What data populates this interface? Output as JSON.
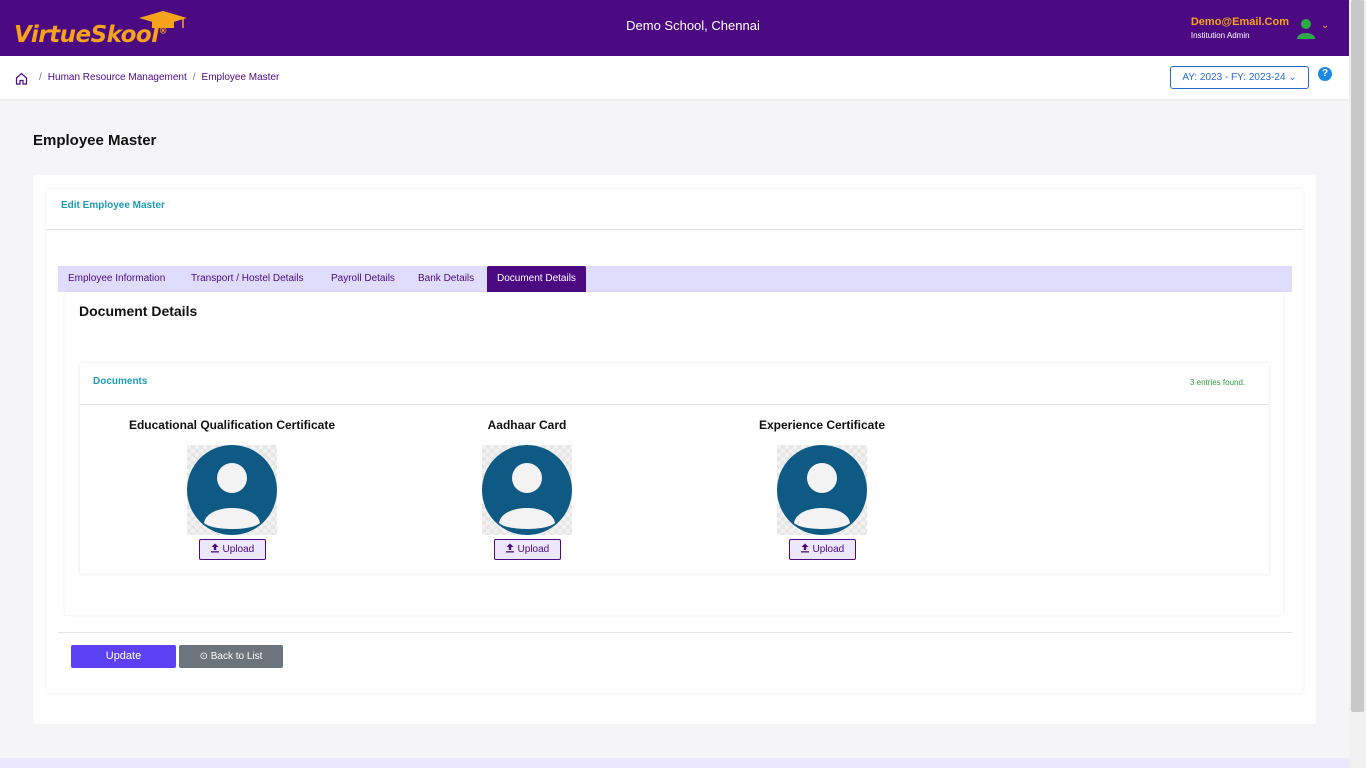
{
  "header": {
    "logo_virtue": "Virtue",
    "logo_skool": "Skool",
    "logo_reg": "®",
    "school_name": "Demo School, Chennai",
    "user_email": "Demo@Email.Com",
    "user_role": "Institution Admin"
  },
  "breadcrumb": {
    "items": [
      "Human Resource Management",
      "Employee Master"
    ],
    "separator": "/",
    "ay_fy": "AY: 2023 - FY: 2023-24 ⌄",
    "help": "?"
  },
  "page": {
    "title": "Employee Master",
    "edit_title": "Edit Employee Master"
  },
  "tabs": [
    {
      "label": "Employee Information",
      "active": false
    },
    {
      "label": "Transport / Hostel Details",
      "active": false
    },
    {
      "label": "Payroll Details",
      "active": false
    },
    {
      "label": "Bank Details",
      "active": false
    },
    {
      "label": "Document Details",
      "active": true
    }
  ],
  "document_panel": {
    "title": "Document Details",
    "documents_title": "Documents",
    "entries": "3 entries found.",
    "documents": [
      {
        "label": "Educational Qualification Certificate",
        "upload_label": "Upload"
      },
      {
        "label": "Aadhaar Card",
        "upload_label": "Upload"
      },
      {
        "label": "Experience Certificate",
        "upload_label": "Upload"
      }
    ]
  },
  "actions": {
    "update_label": "Update",
    "back_label": "Back to List"
  },
  "colors": {
    "brand_purple": "#4b0a82",
    "accent_orange": "#f7a21b",
    "teal": "#1e9bb5",
    "avatar_blue": "#0e5a85",
    "update_button": "#5c41f2",
    "entries_green": "#2e9e3c"
  },
  "icons": {
    "home": "home-icon",
    "user": "user-avatar-icon",
    "upload": "upload-icon",
    "back": "arrow-circle-left-icon",
    "help": "help-icon",
    "graduation_cap": "graduation-cap-icon"
  }
}
